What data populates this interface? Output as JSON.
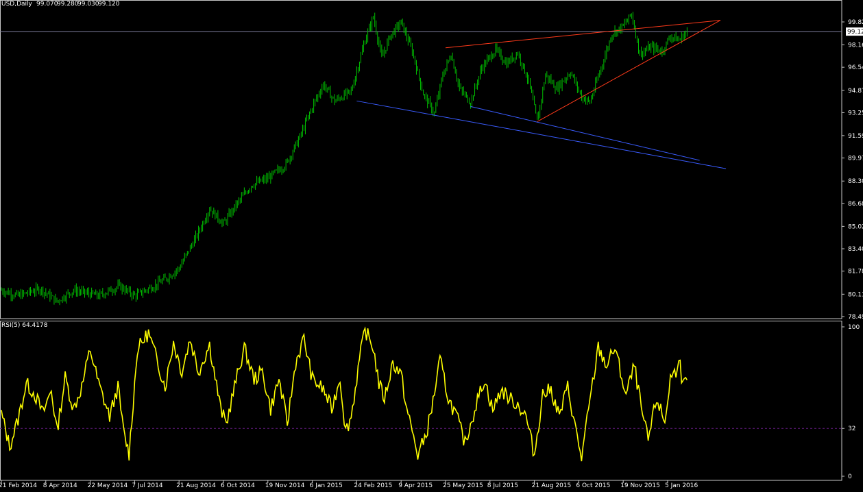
{
  "colors": {
    "background": "#000000",
    "frame": "#c8c8c8",
    "text": "#ffffff",
    "candles": "#00c000",
    "price_line": "#8080a0",
    "rsi_line": "#ffff00",
    "rsi_level": "#6a1c8a",
    "trend_red": "#ff3a1a",
    "trend_blue": "#3a5cff",
    "price_tag_bg": "#ffffff",
    "price_tag_text": "#000000"
  },
  "chart_data": [
    {
      "type": "candlestick",
      "title": "USD,Daily",
      "ohlc": {
        "open": "99.070",
        "high": "99.280",
        "low": "99.030",
        "close": "99.120"
      },
      "ylim": [
        78.49,
        101.2
      ],
      "y_ticks": [
        "99.82",
        "98.16",
        "96.54",
        "94.87",
        "93.25",
        "91.59",
        "89.97",
        "88.30",
        "86.68",
        "85.02",
        "83.40",
        "81.78",
        "80.11",
        "78.49"
      ],
      "y_tick_values": [
        99.82,
        98.16,
        96.54,
        94.87,
        93.25,
        91.59,
        89.97,
        88.3,
        86.68,
        85.02,
        83.4,
        81.78,
        80.11,
        78.49
      ],
      "last_price": "99.12",
      "last_price_value": 99.12,
      "x_ticks": [
        "21 Feb 2014",
        "8 Apr 2014",
        "22 May 2014",
        "7 Jul 2014",
        "21 Aug 2014",
        "6 Oct 2014",
        "19 Nov 2014",
        "6 Jan 2015",
        "24 Feb 2015",
        "9 Apr 2015",
        "25 May 2015",
        "8 Jul 2015",
        "21 Aug 2015",
        "6 Oct 2015",
        "19 Nov 2015",
        "5 Jan 2016"
      ],
      "x_tick_index": [
        0,
        32,
        64,
        96,
        128,
        160,
        192,
        224,
        256,
        288,
        320,
        352,
        384,
        416,
        448,
        480
      ],
      "bar_count": 495,
      "price_path": [
        [
          0,
          80.4
        ],
        [
          12,
          80.0
        ],
        [
          28,
          80.5
        ],
        [
          40,
          79.6
        ],
        [
          52,
          80.4
        ],
        [
          70,
          80.0
        ],
        [
          85,
          80.7
        ],
        [
          96,
          80.0
        ],
        [
          108,
          80.6
        ],
        [
          118,
          81.2
        ],
        [
          128,
          82.0
        ],
        [
          140,
          84.2
        ],
        [
          150,
          86.3
        ],
        [
          160,
          85.2
        ],
        [
          170,
          86.7
        ],
        [
          180,
          88.0
        ],
        [
          192,
          88.5
        ],
        [
          205,
          89.5
        ],
        [
          215,
          91.5
        ],
        [
          225,
          93.9
        ],
        [
          232,
          95.3
        ],
        [
          240,
          94.1
        ],
        [
          252,
          94.8
        ],
        [
          262,
          98.5
        ],
        [
          268,
          100.2
        ],
        [
          274,
          97.2
        ],
        [
          280,
          98.8
        ],
        [
          288,
          99.8
        ],
        [
          296,
          97.7
        ],
        [
          304,
          94.6
        ],
        [
          312,
          93.2
        ],
        [
          318,
          96.0
        ],
        [
          324,
          97.5
        ],
        [
          330,
          95.0
        ],
        [
          338,
          94.0
        ],
        [
          346,
          96.5
        ],
        [
          356,
          97.8
        ],
        [
          364,
          96.8
        ],
        [
          372,
          97.6
        ],
        [
          380,
          95.5
        ],
        [
          386,
          92.6
        ],
        [
          392,
          96.0
        ],
        [
          400,
          95.0
        ],
        [
          410,
          96.2
        ],
        [
          418,
          94.4
        ],
        [
          424,
          94.0
        ],
        [
          432,
          96.5
        ],
        [
          440,
          99.0
        ],
        [
          448,
          99.5
        ],
        [
          454,
          100.4
        ],
        [
          460,
          97.5
        ],
        [
          468,
          98.0
        ],
        [
          476,
          97.7
        ],
        [
          482,
          98.8
        ],
        [
          488,
          98.5
        ],
        [
          494,
          99.12
        ]
      ],
      "trend_lines": [
        {
          "color": "red",
          "from": [
            320,
            97.95
          ],
          "to": [
            518,
            99.94
          ]
        },
        {
          "color": "red",
          "from": [
            386,
            92.6
          ],
          "to": [
            518,
            99.94
          ]
        },
        {
          "color": "blue",
          "from": [
            256,
            94.1
          ],
          "to": [
            522,
            89.2
          ]
        },
        {
          "color": "blue",
          "from": [
            338,
            93.7
          ],
          "to": [
            503,
            89.8
          ]
        }
      ]
    },
    {
      "type": "line",
      "title": "RSI(5) 64.4178",
      "ylim": [
        0,
        100
      ],
      "y_ticks": [
        "100",
        "32",
        "0"
      ],
      "y_tick_values": [
        100,
        32,
        0
      ],
      "level": 32,
      "last_value": 64.4178,
      "rsi_keypoints": [
        [
          0,
          42
        ],
        [
          6,
          20
        ],
        [
          12,
          38
        ],
        [
          18,
          62
        ],
        [
          24,
          55
        ],
        [
          30,
          42
        ],
        [
          36,
          58
        ],
        [
          40,
          30
        ],
        [
          46,
          66
        ],
        [
          52,
          45
        ],
        [
          58,
          60
        ],
        [
          64,
          85
        ],
        [
          70,
          62
        ],
        [
          78,
          40
        ],
        [
          84,
          60
        ],
        [
          88,
          30
        ],
        [
          92,
          15
        ],
        [
          98,
          85
        ],
        [
          106,
          96
        ],
        [
          112,
          78
        ],
        [
          118,
          60
        ],
        [
          124,
          90
        ],
        [
          130,
          70
        ],
        [
          136,
          92
        ],
        [
          142,
          70
        ],
        [
          150,
          88
        ],
        [
          158,
          45
        ],
        [
          162,
          35
        ],
        [
          168,
          60
        ],
        [
          175,
          86
        ],
        [
          182,
          65
        ],
        [
          188,
          70
        ],
        [
          194,
          45
        ],
        [
          200,
          65
        ],
        [
          206,
          35
        ],
        [
          212,
          76
        ],
        [
          218,
          92
        ],
        [
          224,
          65
        ],
        [
          232,
          58
        ],
        [
          238,
          45
        ],
        [
          244,
          66
        ],
        [
          248,
          30
        ],
        [
          252,
          40
        ],
        [
          258,
          78
        ],
        [
          262,
          98
        ],
        [
          268,
          86
        ],
        [
          272,
          62
        ],
        [
          276,
          52
        ],
        [
          282,
          76
        ],
        [
          288,
          68
        ],
        [
          292,
          45
        ],
        [
          296,
          30
        ],
        [
          300,
          14
        ],
        [
          306,
          28
        ],
        [
          310,
          45
        ],
        [
          316,
          78
        ],
        [
          322,
          52
        ],
        [
          328,
          40
        ],
        [
          334,
          22
        ],
        [
          342,
          48
        ],
        [
          348,
          65
        ],
        [
          354,
          44
        ],
        [
          360,
          58
        ],
        [
          366,
          52
        ],
        [
          372,
          48
        ],
        [
          378,
          40
        ],
        [
          384,
          14
        ],
        [
          390,
          55
        ],
        [
          396,
          58
        ],
        [
          402,
          40
        ],
        [
          408,
          60
        ],
        [
          414,
          30
        ],
        [
          418,
          12
        ],
        [
          424,
          50
        ],
        [
          430,
          86
        ],
        [
          436,
          74
        ],
        [
          442,
          86
        ],
        [
          446,
          70
        ],
        [
          450,
          54
        ],
        [
          456,
          74
        ],
        [
          462,
          40
        ],
        [
          466,
          24
        ],
        [
          472,
          52
        ],
        [
          478,
          36
        ],
        [
          482,
          66
        ],
        [
          486,
          70
        ],
        [
          488,
          82
        ],
        [
          491,
          60
        ],
        [
          494,
          64.4
        ]
      ]
    }
  ]
}
